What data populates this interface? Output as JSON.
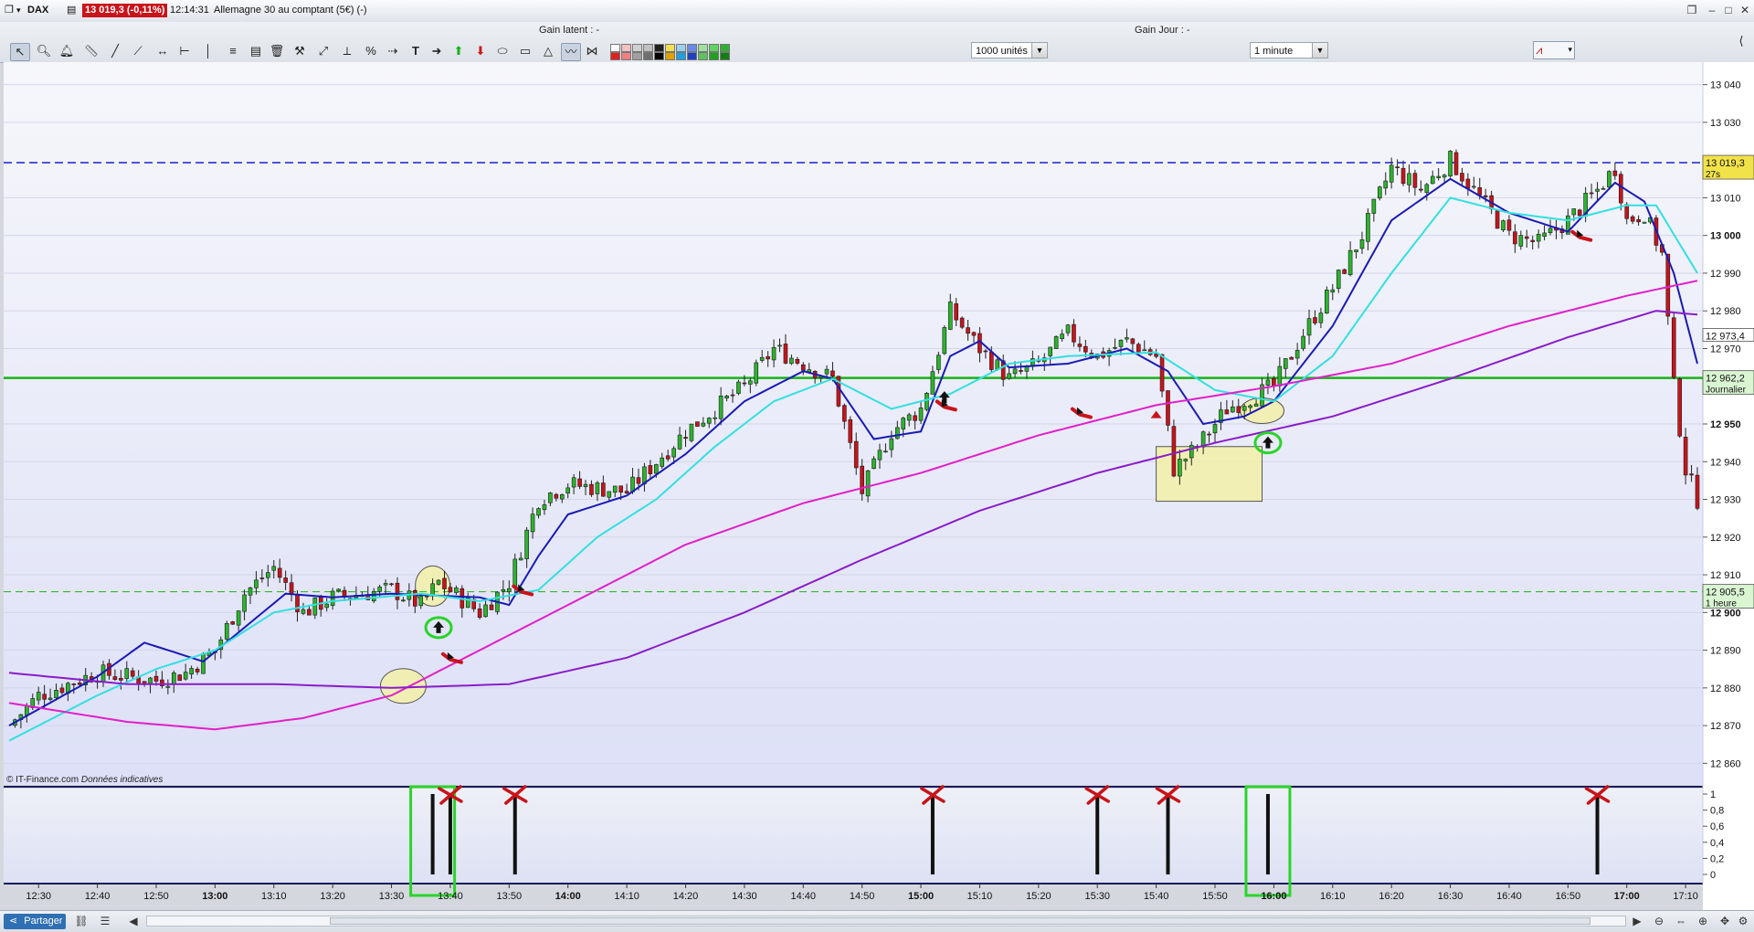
{
  "window": {
    "symbol": "DAX",
    "price_badge": "13 019,3 (-0,11%)",
    "time": "12:14:31",
    "instrument": "Allemagne 30 au comptant (5€) (-)"
  },
  "toolbar": {
    "gain_latent": "Gain latent : -",
    "gain_jour": "Gain Jour : -",
    "size_select": "1000 unités",
    "period_select": "1 minute"
  },
  "colors": {
    "background_top": "#f6f7fb",
    "background_bottom": "#dde0f7",
    "bull": "#2bb52b",
    "bear": "#c8141a",
    "ema_fast": "#1a1ab5",
    "ema_cyan": "#33e0e0",
    "ma_magenta": "#e020c8",
    "ma_purple": "#8a1cc8",
    "level_blue": "#1a22c8",
    "level_green": "#19b219",
    "annotation_green": "#2ad42a",
    "annotation_highlight": "#f3f0a8"
  },
  "price_axis": {
    "ticks": [
      {
        "label": "13 040",
        "value": 13040,
        "bold": false
      },
      {
        "label": "13 030",
        "value": 13030,
        "bold": false
      },
      {
        "label": "13 010",
        "value": 13010,
        "bold": false
      },
      {
        "label": "13 000",
        "value": 13000,
        "bold": true
      },
      {
        "label": "12 990",
        "value": 12990,
        "bold": false
      },
      {
        "label": "12 980",
        "value": 12980,
        "bold": false
      },
      {
        "label": "12 970",
        "value": 12970,
        "bold": false
      },
      {
        "label": "12 950",
        "value": 12950,
        "bold": true
      },
      {
        "label": "12 940",
        "value": 12940,
        "bold": false
      },
      {
        "label": "12 930",
        "value": 12930,
        "bold": false
      },
      {
        "label": "12 920",
        "value": 12920,
        "bold": false
      },
      {
        "label": "12 910",
        "value": 12910,
        "bold": false
      },
      {
        "label": "12 900",
        "value": 12900,
        "bold": true
      },
      {
        "label": "12 890",
        "value": 12890,
        "bold": false
      },
      {
        "label": "12 880",
        "value": 12880,
        "bold": false
      },
      {
        "label": "12 870",
        "value": 12870,
        "bold": false
      },
      {
        "label": "12 860",
        "value": 12860,
        "bold": false
      }
    ],
    "tags": [
      {
        "label": "13 019,3",
        "sub": "27s",
        "value": 13019.3,
        "color": "#f2e24a"
      },
      {
        "label": "12 973,4",
        "sub": "",
        "value": 12973.4,
        "color": "#ffffff"
      },
      {
        "label": "12 962,2",
        "sub": "Journalier",
        "value": 12962.2,
        "color": "#d9f5d2"
      },
      {
        "label": "12 905,5",
        "sub": "1 heure",
        "value": 12905.5,
        "color": "#d9f5d2"
      }
    ]
  },
  "time_axis": {
    "ticks": [
      {
        "label": "12:30",
        "bold": false
      },
      {
        "label": "12:40",
        "bold": false
      },
      {
        "label": "12:50",
        "bold": false
      },
      {
        "label": "13:00",
        "bold": true
      },
      {
        "label": "13:10",
        "bold": false
      },
      {
        "label": "13:20",
        "bold": false
      },
      {
        "label": "13:30",
        "bold": false
      },
      {
        "label": "13:40",
        "bold": false
      },
      {
        "label": "13:50",
        "bold": false
      },
      {
        "label": "14:00",
        "bold": true
      },
      {
        "label": "14:10",
        "bold": false
      },
      {
        "label": "14:20",
        "bold": false
      },
      {
        "label": "14:30",
        "bold": false
      },
      {
        "label": "14:40",
        "bold": false
      },
      {
        "label": "14:50",
        "bold": false
      },
      {
        "label": "15:00",
        "bold": true
      },
      {
        "label": "15:10",
        "bold": false
      },
      {
        "label": "15:20",
        "bold": false
      },
      {
        "label": "15:30",
        "bold": false
      },
      {
        "label": "15:40",
        "bold": false
      },
      {
        "label": "15:50",
        "bold": false
      },
      {
        "label": "16:00",
        "bold": true
      },
      {
        "label": "16:10",
        "bold": false
      },
      {
        "label": "16:20",
        "bold": false
      },
      {
        "label": "16:30",
        "bold": false
      },
      {
        "label": "16:40",
        "bold": false
      },
      {
        "label": "16:50",
        "bold": false
      },
      {
        "label": "17:00",
        "bold": true
      },
      {
        "label": "17:10",
        "bold": false
      }
    ]
  },
  "indicator_axis": {
    "ticks": [
      "1",
      "0,8",
      "0,6",
      "0,4",
      "0,2",
      "0"
    ]
  },
  "credit": "© IT-Finance.com",
  "credit_italic": "Données indicatives",
  "chart_data": {
    "type": "candlestick",
    "instrument": "DAX",
    "interval": "1 minute",
    "time_range": [
      "12:25",
      "17:12"
    ],
    "ylim": [
      12855,
      13045
    ],
    "horizontal_levels": [
      13019.3,
      12962.2,
      12905.5
    ],
    "close_path": [
      {
        "t": "12:25",
        "v": 12870
      },
      {
        "t": "12:30",
        "v": 12878
      },
      {
        "t": "12:40",
        "v": 12884
      },
      {
        "t": "12:50",
        "v": 12882
      },
      {
        "t": "12:55",
        "v": 12884
      },
      {
        "t": "13:00",
        "v": 12890
      },
      {
        "t": "13:05",
        "v": 12905
      },
      {
        "t": "13:10",
        "v": 12912
      },
      {
        "t": "13:15",
        "v": 12900
      },
      {
        "t": "13:20",
        "v": 12904
      },
      {
        "t": "13:30",
        "v": 12906
      },
      {
        "t": "13:35",
        "v": 12902
      },
      {
        "t": "13:38",
        "v": 12908
      },
      {
        "t": "13:45",
        "v": 12900
      },
      {
        "t": "13:50",
        "v": 12908
      },
      {
        "t": "13:55",
        "v": 12930
      },
      {
        "t": "14:00",
        "v": 12934
      },
      {
        "t": "14:10",
        "v": 12932
      },
      {
        "t": "14:20",
        "v": 12948
      },
      {
        "t": "14:30",
        "v": 12960
      },
      {
        "t": "14:35",
        "v": 12970
      },
      {
        "t": "14:40",
        "v": 12966
      },
      {
        "t": "14:45",
        "v": 12962
      },
      {
        "t": "14:50",
        "v": 12932
      },
      {
        "t": "14:55",
        "v": 12948
      },
      {
        "t": "15:00",
        "v": 12954
      },
      {
        "t": "15:05",
        "v": 12980
      },
      {
        "t": "15:10",
        "v": 12970
      },
      {
        "t": "15:15",
        "v": 12962
      },
      {
        "t": "15:20",
        "v": 12966
      },
      {
        "t": "15:25",
        "v": 12974
      },
      {
        "t": "15:30",
        "v": 12968
      },
      {
        "t": "15:35",
        "v": 12972
      },
      {
        "t": "15:40",
        "v": 12968
      },
      {
        "t": "15:43",
        "v": 12938
      },
      {
        "t": "15:47",
        "v": 12944
      },
      {
        "t": "15:52",
        "v": 12954
      },
      {
        "t": "16:00",
        "v": 12960
      },
      {
        "t": "16:05",
        "v": 12974
      },
      {
        "t": "16:10",
        "v": 12986
      },
      {
        "t": "16:15",
        "v": 13000
      },
      {
        "t": "16:20",
        "v": 13018
      },
      {
        "t": "16:25",
        "v": 13012
      },
      {
        "t": "16:30",
        "v": 13020
      },
      {
        "t": "16:35",
        "v": 13010
      },
      {
        "t": "16:40",
        "v": 13000
      },
      {
        "t": "16:45",
        "v": 12998
      },
      {
        "t": "16:50",
        "v": 13004
      },
      {
        "t": "16:55",
        "v": 13012
      },
      {
        "t": "16:58",
        "v": 13018
      },
      {
        "t": "17:00",
        "v": 13004
      },
      {
        "t": "17:03",
        "v": 13006
      },
      {
        "t": "17:06",
        "v": 12995
      },
      {
        "t": "17:08",
        "v": 12960
      },
      {
        "t": "17:10",
        "v": 12938
      },
      {
        "t": "17:12",
        "v": 12930
      }
    ],
    "series": [
      {
        "color": "#1a1ab5",
        "points": [
          {
            "t": "12:25",
            "v": 12870
          },
          {
            "t": "12:40",
            "v": 12883
          },
          {
            "t": "12:48",
            "v": 12892
          },
          {
            "t": "12:58",
            "v": 12887
          },
          {
            "t": "13:05",
            "v": 12896
          },
          {
            "t": "13:12",
            "v": 12905
          },
          {
            "t": "13:20",
            "v": 12904
          },
          {
            "t": "13:30",
            "v": 12905
          },
          {
            "t": "13:45",
            "v": 12904
          },
          {
            "t": "13:50",
            "v": 12902
          },
          {
            "t": "13:55",
            "v": 12915
          },
          {
            "t": "14:00",
            "v": 12926
          },
          {
            "t": "14:10",
            "v": 12931
          },
          {
            "t": "14:20",
            "v": 12942
          },
          {
            "t": "14:30",
            "v": 12956
          },
          {
            "t": "14:40",
            "v": 12964
          },
          {
            "t": "14:45",
            "v": 12962
          },
          {
            "t": "14:52",
            "v": 12946
          },
          {
            "t": "15:00",
            "v": 12948
          },
          {
            "t": "15:05",
            "v": 12968
          },
          {
            "t": "15:10",
            "v": 12972
          },
          {
            "t": "15:15",
            "v": 12965
          },
          {
            "t": "15:25",
            "v": 12966
          },
          {
            "t": "15:35",
            "v": 12970
          },
          {
            "t": "15:42",
            "v": 12964
          },
          {
            "t": "15:48",
            "v": 12950
          },
          {
            "t": "15:55",
            "v": 12952
          },
          {
            "t": "16:00",
            "v": 12956
          },
          {
            "t": "16:10",
            "v": 12976
          },
          {
            "t": "16:20",
            "v": 13004
          },
          {
            "t": "16:30",
            "v": 13015
          },
          {
            "t": "16:40",
            "v": 13006
          },
          {
            "t": "16:50",
            "v": 13001
          },
          {
            "t": "16:58",
            "v": 13014
          },
          {
            "t": "17:03",
            "v": 13009
          },
          {
            "t": "17:08",
            "v": 12990
          },
          {
            "t": "17:12",
            "v": 12966
          }
        ]
      },
      {
        "color": "#33e0e0",
        "points": [
          {
            "t": "12:25",
            "v": 12866
          },
          {
            "t": "12:40",
            "v": 12878
          },
          {
            "t": "12:50",
            "v": 12885
          },
          {
            "t": "13:00",
            "v": 12890
          },
          {
            "t": "13:10",
            "v": 12900
          },
          {
            "t": "13:20",
            "v": 12903
          },
          {
            "t": "13:35",
            "v": 12905
          },
          {
            "t": "13:45",
            "v": 12903
          },
          {
            "t": "13:55",
            "v": 12906
          },
          {
            "t": "14:05",
            "v": 12920
          },
          {
            "t": "14:15",
            "v": 12930
          },
          {
            "t": "14:25",
            "v": 12944
          },
          {
            "t": "14:35",
            "v": 12956
          },
          {
            "t": "14:45",
            "v": 12962
          },
          {
            "t": "14:55",
            "v": 12954
          },
          {
            "t": "15:05",
            "v": 12958
          },
          {
            "t": "15:15",
            "v": 12966
          },
          {
            "t": "15:25",
            "v": 12968
          },
          {
            "t": "15:40",
            "v": 12969
          },
          {
            "t": "15:50",
            "v": 12959
          },
          {
            "t": "16:00",
            "v": 12956
          },
          {
            "t": "16:10",
            "v": 12968
          },
          {
            "t": "16:20",
            "v": 12990
          },
          {
            "t": "16:30",
            "v": 13010
          },
          {
            "t": "16:40",
            "v": 13006
          },
          {
            "t": "16:50",
            "v": 13004
          },
          {
            "t": "17:00",
            "v": 13008
          },
          {
            "t": "17:05",
            "v": 13008
          },
          {
            "t": "17:12",
            "v": 12990
          }
        ]
      },
      {
        "color": "#e020c8",
        "points": [
          {
            "t": "12:25",
            "v": 12876
          },
          {
            "t": "12:45",
            "v": 12871
          },
          {
            "t": "13:00",
            "v": 12869
          },
          {
            "t": "13:15",
            "v": 12872
          },
          {
            "t": "13:30",
            "v": 12878
          },
          {
            "t": "13:45",
            "v": 12890
          },
          {
            "t": "14:00",
            "v": 12902
          },
          {
            "t": "14:20",
            "v": 12918
          },
          {
            "t": "14:40",
            "v": 12929
          },
          {
            "t": "15:00",
            "v": 12937
          },
          {
            "t": "15:20",
            "v": 12947
          },
          {
            "t": "15:40",
            "v": 12955
          },
          {
            "t": "16:00",
            "v": 12960
          },
          {
            "t": "16:20",
            "v": 12966
          },
          {
            "t": "16:40",
            "v": 12976
          },
          {
            "t": "17:00",
            "v": 12984
          },
          {
            "t": "17:12",
            "v": 12988
          }
        ]
      },
      {
        "color": "#8a1cc8",
        "points": [
          {
            "t": "12:25",
            "v": 12884
          },
          {
            "t": "12:45",
            "v": 12881
          },
          {
            "t": "13:10",
            "v": 12881
          },
          {
            "t": "13:30",
            "v": 12880
          },
          {
            "t": "13:50",
            "v": 12881
          },
          {
            "t": "14:10",
            "v": 12888
          },
          {
            "t": "14:30",
            "v": 12900
          },
          {
            "t": "14:50",
            "v": 12914
          },
          {
            "t": "15:10",
            "v": 12927
          },
          {
            "t": "15:30",
            "v": 12937
          },
          {
            "t": "15:50",
            "v": 12945
          },
          {
            "t": "16:10",
            "v": 12952
          },
          {
            "t": "16:30",
            "v": 12962
          },
          {
            "t": "16:50",
            "v": 12973
          },
          {
            "t": "17:05",
            "v": 12980
          },
          {
            "t": "17:12",
            "v": 12979
          }
        ]
      }
    ],
    "signals": [
      {
        "t": "13:37",
        "value": 1,
        "annotation": "green-box"
      },
      {
        "t": "13:40",
        "value": 1,
        "annotation": "red-x"
      },
      {
        "t": "13:51",
        "value": 1,
        "annotation": "red-x"
      },
      {
        "t": "15:02",
        "value": 1,
        "annotation": "red-x"
      },
      {
        "t": "15:30",
        "value": 1,
        "annotation": "red-x"
      },
      {
        "t": "15:42",
        "value": 1,
        "annotation": "red-x"
      },
      {
        "t": "15:59",
        "value": 1,
        "annotation": "green-box"
      },
      {
        "t": "16:55",
        "value": 1,
        "annotation": "red-x"
      }
    ],
    "indicator_ylim": [
      0,
      1
    ]
  }
}
